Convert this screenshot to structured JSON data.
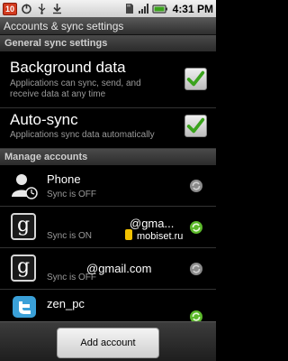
{
  "status_bar": {
    "notification_count": "10",
    "time": "4:31 PM",
    "icons": [
      "notification-badge",
      "power-icon",
      "usb-icon",
      "download-icon",
      "sd-card-icon",
      "signal-icon",
      "battery-icon"
    ]
  },
  "title_bar": {
    "title": "Accounts & sync settings"
  },
  "general": {
    "header": "General sync settings",
    "items": [
      {
        "title": "Background data",
        "subtitle": "Applications can sync, send, and receive data at any time",
        "checked": true
      },
      {
        "title": "Auto-sync",
        "subtitle": "Applications sync data automatically",
        "checked": true
      }
    ]
  },
  "manage": {
    "header": "Manage accounts",
    "accounts": [
      {
        "name": "Phone",
        "status": "Sync is OFF",
        "icon": "contact-person-icon",
        "sync_state": "off"
      },
      {
        "name": "",
        "status": "Sync is ON",
        "icon": "google-g-icon",
        "sync_state": "on"
      },
      {
        "name": "",
        "status": "Sync is OFF",
        "icon": "google-g-icon",
        "sync_state": "off"
      },
      {
        "name": "zen_pc",
        "status": "",
        "icon": "twitter-bird-icon",
        "sync_state": "on"
      }
    ]
  },
  "watermarks": {
    "email1": "@gma...",
    "site": "mobiset.ru",
    "email2": "@gmail.com"
  },
  "bottom": {
    "add_account_label": "Add account"
  },
  "colors": {
    "check_green": "#3aa31c",
    "sync_on_green": "#5bb82a",
    "sync_off_gray": "#8a8a8a"
  }
}
